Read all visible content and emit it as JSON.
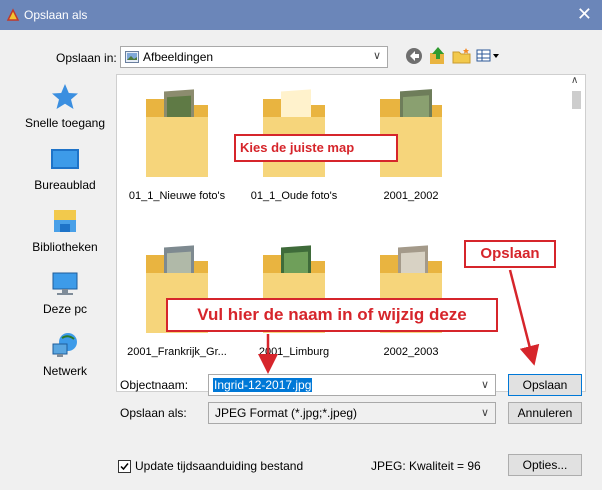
{
  "window": {
    "title": "Opslaan als"
  },
  "toolbar": {
    "lookin_label": "Opslaan in:",
    "lookin_value": "Afbeeldingen",
    "icons": [
      "back-icon",
      "up-folder-icon",
      "new-folder-icon",
      "view-menu-icon"
    ]
  },
  "places": [
    {
      "label": "Snelle toegang",
      "icon": "star-icon"
    },
    {
      "label": "Bureaublad",
      "icon": "desktop-icon"
    },
    {
      "label": "Bibliotheken",
      "icon": "libraries-icon"
    },
    {
      "label": "Deze pc",
      "icon": "computer-icon"
    },
    {
      "label": "Netwerk",
      "icon": "network-icon"
    }
  ],
  "folders": [
    {
      "name": "01_1_Nieuwe foto's"
    },
    {
      "name": "01_1_Oude foto's"
    },
    {
      "name": "2001_2002"
    },
    {
      "name": "2001_Frankrijk_Gr..."
    },
    {
      "name": "2001_Limburg"
    },
    {
      "name": "2002_2003"
    }
  ],
  "form": {
    "name_label": "Objectnaam:",
    "name_value": "Ingrid-12-2017.jpg",
    "type_label": "Opslaan als:",
    "type_value": "JPEG Format (*.jpg;*.jpeg)",
    "save_button": "Opslaan",
    "cancel_button": "Annuleren",
    "options_button": "Opties...",
    "timestamp_checkbox": "Update tijdsaanduiding bestand",
    "timestamp_checked": true,
    "quality": "JPEG: Kwaliteit = 96"
  },
  "annotations": {
    "choose_folder": "Kies de juiste map",
    "save": "Opslaan",
    "enter_name": "Vul hier de naam in of wijzig deze"
  },
  "colors": {
    "titlebar": "#6b86b9",
    "annotation": "#d6252b",
    "selection": "#0078d7",
    "folder": "#f6d57b"
  }
}
